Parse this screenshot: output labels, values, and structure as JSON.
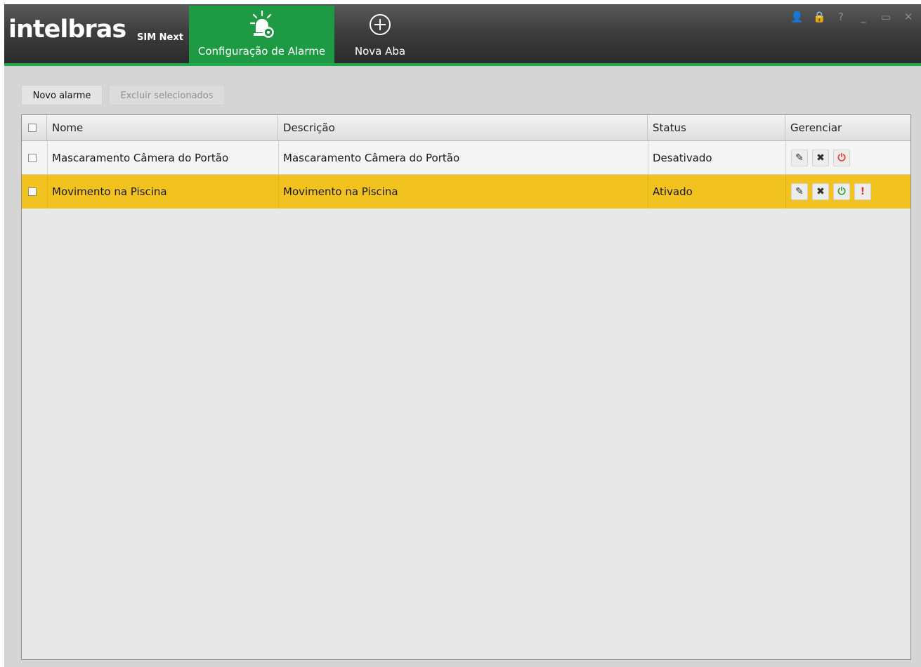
{
  "app": {
    "brand": "intelbras",
    "product": "SIM Next"
  },
  "tabs": [
    {
      "label": "Configuração de Alarme",
      "icon": "alarm-gear-icon",
      "active": true
    },
    {
      "label": "Nova Aba",
      "icon": "plus-circle-icon",
      "active": false
    }
  ],
  "window_controls": [
    "user-icon",
    "lock-icon",
    "help-icon",
    "minimize-icon",
    "maximize-icon",
    "close-icon"
  ],
  "window_control_glyphs": {
    "user": "👤",
    "lock": "🔒",
    "help": "?",
    "minimize": "_",
    "maximize": "▭",
    "close": "✕"
  },
  "toolbar": {
    "new_alarm_label": "Novo alarme",
    "delete_selected_label": "Excluir selecionados",
    "delete_selected_enabled": false
  },
  "table": {
    "columns": [
      "Nome",
      "Descrição",
      "Status",
      "Gerenciar"
    ],
    "rows": [
      {
        "nome": "Mascaramento Câmera do Portão",
        "descricao": "Mascaramento Câmera do Portão",
        "status": "Desativado",
        "selected": false,
        "actions": [
          "edit-icon",
          "delete-icon",
          "power-icon"
        ]
      },
      {
        "nome": "Movimento na Piscina",
        "descricao": "Movimento na Piscina",
        "status": "Ativado",
        "selected": true,
        "actions": [
          "edit-icon",
          "delete-icon",
          "power-icon",
          "warning-icon"
        ]
      }
    ]
  },
  "colors": {
    "accent_green": "#1e9a44",
    "selected_row": "#f2c21e",
    "power_off_red": "#e33b2e",
    "power_on_green": "#2f9e3c",
    "warning_red": "#e8302a"
  },
  "glyphs": {
    "edit": "✎",
    "delete": "✖",
    "power": "⏻",
    "warning": "!"
  }
}
